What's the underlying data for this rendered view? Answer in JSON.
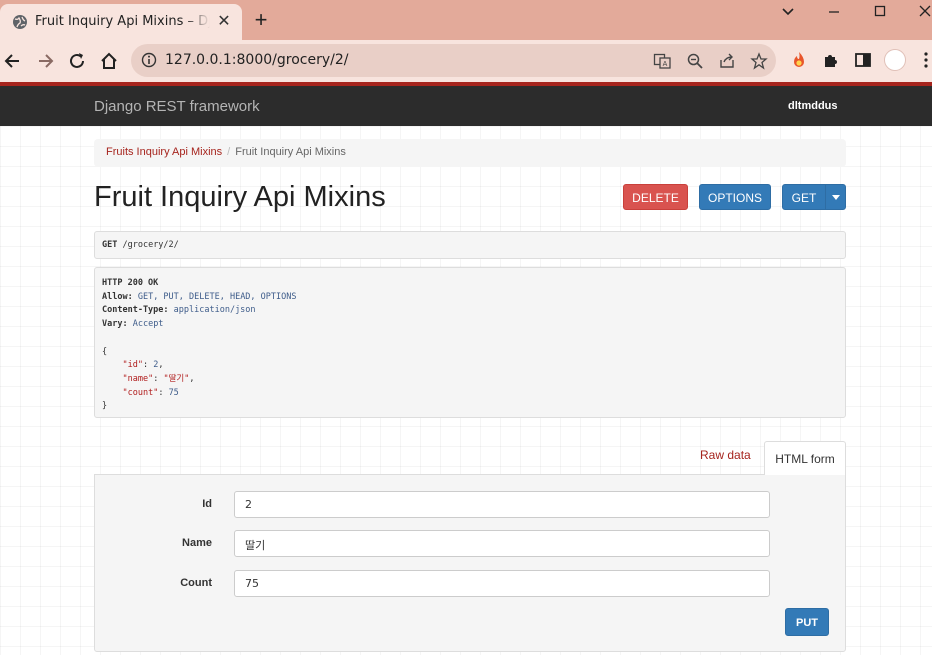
{
  "browser": {
    "tab_title": "Fruit Inquiry Api Mixins – Django REST framework",
    "url": "127.0.0.1:8000/grocery/2/",
    "accent": "#a6241d"
  },
  "navbar": {
    "brand": "Django REST framework",
    "user": "dltmddus"
  },
  "breadcrumb": {
    "items": [
      "Fruits Inquiry Api Mixins",
      "Fruit Inquiry Api Mixins"
    ],
    "separator": "/"
  },
  "page": {
    "title": "Fruit Inquiry Api Mixins"
  },
  "actions": {
    "delete": "DELETE",
    "options": "OPTIONS",
    "get": "GET"
  },
  "request": {
    "method": "GET",
    "path": "/grocery/2/"
  },
  "response": {
    "status": "HTTP 200 OK",
    "allow_key": "Allow:",
    "allow": "GET, PUT, DELETE, HEAD, OPTIONS",
    "content_type_key": "Content-Type:",
    "content_type": "application/json",
    "vary_key": "Vary:",
    "vary": "Accept",
    "open_brace": "{",
    "close_brace": "}",
    "body": [
      {
        "key": "\"id\"",
        "value": "2",
        "kind": "number"
      },
      {
        "key": "\"name\"",
        "value": "\"딸기\"",
        "kind": "string"
      },
      {
        "key": "\"count\"",
        "value": "75",
        "kind": "number"
      }
    ]
  },
  "form_tabs": {
    "raw": "Raw data",
    "html": "HTML form"
  },
  "form": {
    "id_label": "Id",
    "id_value": "2",
    "name_label": "Name",
    "name_value": "딸기",
    "count_label": "Count",
    "count_value": "75",
    "submit": "PUT"
  }
}
